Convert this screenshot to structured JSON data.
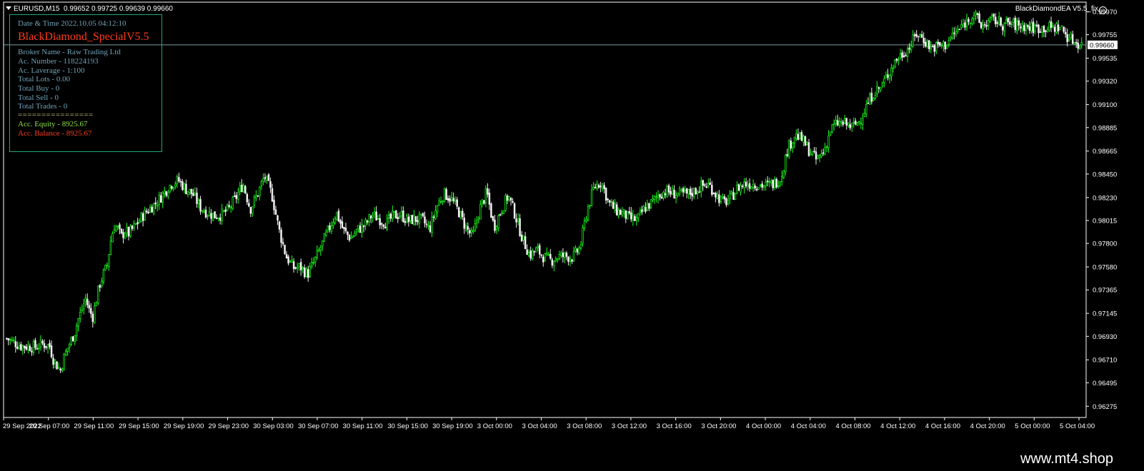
{
  "header": {
    "symbol": "EURUSD,M15",
    "ohlc": "0.99652 0.99725 0.99639 0.99660",
    "ea_name": "BlackDiamondEA V5.5_fix"
  },
  "info_panel": {
    "datetime": "Date & Time 2022.10.05 04:12:10",
    "title": "BlackDiamond_SpecialV5.5",
    "broker": "Broker Name - Raw Trading Ltd",
    "ac_number": "Ac. Number - 118224193",
    "leverage": "Ac. Laverage - 1:100",
    "total_lots": "Total Lots - 0.00",
    "total_buy": "Total Buy - 0",
    "total_sell": "Total Sell - 0",
    "total_trades": "Total Trades - 0",
    "separator": "================",
    "equity": "Acc. Equity - 8925.67",
    "balance": "Acc. Balance - 8925.67"
  },
  "chart_data": {
    "type": "candlestick",
    "symbol": "EURUSD",
    "timeframe": "M15",
    "current_price": 0.9966,
    "price_labels": [
      "0.99970",
      "0.99755",
      "0.99535",
      "0.99320",
      "0.99100",
      "0.98885",
      "0.98665",
      "0.98450",
      "0.98230",
      "0.98015",
      "0.97800",
      "0.97580",
      "0.97365",
      "0.97145",
      "0.96930",
      "0.96710",
      "0.96495",
      "0.96275"
    ],
    "price_values": [
      0.9997,
      0.99755,
      0.99535,
      0.9932,
      0.991,
      0.98885,
      0.98665,
      0.9845,
      0.9823,
      0.98015,
      0.978,
      0.9758,
      0.97365,
      0.97145,
      0.9693,
      0.9671,
      0.96495,
      0.96275
    ],
    "time_labels": [
      "29 Sep 2022",
      "29 Sep 07:00",
      "29 Sep 11:00",
      "29 Sep 15:00",
      "29 Sep 19:00",
      "29 Sep 23:00",
      "30 Sep 03:00",
      "30 Sep 07:00",
      "30 Sep 11:00",
      "30 Sep 15:00",
      "30 Sep 19:00",
      "3 Oct 00:00",
      "3 Oct 04:00",
      "3 Oct 08:00",
      "3 Oct 12:00",
      "3 Oct 16:00",
      "3 Oct 20:00",
      "4 Oct 00:00",
      "4 Oct 04:00",
      "4 Oct 08:00",
      "4 Oct 12:00",
      "4 Oct 16:00",
      "4 Oct 20:00",
      "5 Oct 00:00",
      "5 Oct 04:00"
    ],
    "y_range": [
      0.9617,
      1.0006
    ],
    "close_path": [
      [
        0,
        0.9691
      ],
      [
        2,
        0.9684
      ],
      [
        4,
        0.9683
      ],
      [
        5,
        0.9686
      ],
      [
        6,
        0.9684
      ],
      [
        6.5,
        0.9672
      ],
      [
        7,
        0.9666
      ],
      [
        7.5,
        0.9661
      ],
      [
        8,
        0.9673
      ],
      [
        8.5,
        0.9682
      ],
      [
        9,
        0.9689
      ],
      [
        9.5,
        0.9697
      ],
      [
        10,
        0.9709
      ],
      [
        10.5,
        0.9718
      ],
      [
        11,
        0.9729
      ],
      [
        11.5,
        0.9718
      ],
      [
        12,
        0.9711
      ],
      [
        12.5,
        0.9727
      ],
      [
        13,
        0.9742
      ],
      [
        13.5,
        0.9751
      ],
      [
        14,
        0.9759
      ],
      [
        14.5,
        0.9782
      ],
      [
        15,
        0.9797
      ],
      [
        15.5,
        0.9794
      ],
      [
        16,
        0.9786
      ],
      [
        16.5,
        0.9792
      ],
      [
        17,
        0.9789
      ],
      [
        18,
        0.9797
      ],
      [
        19,
        0.9806
      ],
      [
        20,
        0.9813
      ],
      [
        21,
        0.9819
      ],
      [
        22,
        0.9828
      ],
      [
        23,
        0.9836
      ],
      [
        24,
        0.9839
      ],
      [
        25,
        0.9831
      ],
      [
        26,
        0.9826
      ],
      [
        27,
        0.9814
      ],
      [
        28,
        0.9809
      ],
      [
        29,
        0.9806
      ],
      [
        30,
        0.9807
      ],
      [
        31,
        0.9812
      ],
      [
        32,
        0.9823
      ],
      [
        33,
        0.9836
      ],
      [
        34,
        0.9812
      ],
      [
        35,
        0.9826
      ],
      [
        36,
        0.9843
      ],
      [
        37,
        0.9826
      ],
      [
        38,
        0.9793
      ],
      [
        39,
        0.9768
      ],
      [
        40,
        0.9757
      ],
      [
        41,
        0.9758
      ],
      [
        42,
        0.9751
      ],
      [
        43,
        0.9764
      ],
      [
        44,
        0.9779
      ],
      [
        45,
        0.9794
      ],
      [
        46,
        0.9809
      ],
      [
        47,
        0.9792
      ],
      [
        48,
        0.9785
      ],
      [
        49,
        0.9793
      ],
      [
        50,
        0.9797
      ],
      [
        51,
        0.9807
      ],
      [
        52,
        0.9803
      ],
      [
        53,
        0.9799
      ],
      [
        54,
        0.9806
      ],
      [
        55,
        0.9807
      ],
      [
        56,
        0.9801
      ],
      [
        57,
        0.9803
      ],
      [
        58,
        0.9802
      ],
      [
        59,
        0.9793
      ],
      [
        60,
        0.9814
      ],
      [
        61,
        0.9827
      ],
      [
        62,
        0.9822
      ],
      [
        63,
        0.9811
      ],
      [
        64,
        0.9796
      ],
      [
        65,
        0.9786
      ],
      [
        66,
        0.9812
      ],
      [
        67,
        0.9828
      ],
      [
        68,
        0.9795
      ],
      [
        69,
        0.9811
      ],
      [
        70,
        0.9825
      ],
      [
        71,
        0.9806
      ],
      [
        72,
        0.9784
      ],
      [
        73,
        0.9769
      ],
      [
        74,
        0.9774
      ],
      [
        75,
        0.9767
      ],
      [
        76,
        0.9764
      ],
      [
        77,
        0.9768
      ],
      [
        78,
        0.9768
      ],
      [
        79,
        0.9767
      ],
      [
        80,
        0.9776
      ],
      [
        81,
        0.9811
      ],
      [
        82,
        0.9833
      ],
      [
        83,
        0.9838
      ],
      [
        84,
        0.9818
      ],
      [
        85,
        0.9811
      ],
      [
        86,
        0.9808
      ],
      [
        87,
        0.9803
      ],
      [
        88,
        0.9802
      ],
      [
        89,
        0.9813
      ],
      [
        90,
        0.9818
      ],
      [
        91,
        0.9826
      ],
      [
        92,
        0.9829
      ],
      [
        93,
        0.9827
      ],
      [
        94,
        0.9826
      ],
      [
        95,
        0.9826
      ],
      [
        96,
        0.9829
      ],
      [
        97,
        0.9834
      ],
      [
        98,
        0.9835
      ],
      [
        99,
        0.9826
      ],
      [
        100,
        0.9818
      ],
      [
        101,
        0.9822
      ],
      [
        102,
        0.9832
      ],
      [
        103,
        0.9836
      ],
      [
        104,
        0.9836
      ],
      [
        105,
        0.9835
      ],
      [
        106,
        0.9834
      ],
      [
        107,
        0.9836
      ],
      [
        108,
        0.9841
      ],
      [
        109,
        0.9869
      ],
      [
        110,
        0.9882
      ],
      [
        111,
        0.9877
      ],
      [
        112,
        0.9867
      ],
      [
        113,
        0.9858
      ],
      [
        114,
        0.9866
      ],
      [
        115,
        0.9887
      ],
      [
        116,
        0.9893
      ],
      [
        117,
        0.9892
      ],
      [
        118,
        0.9889
      ],
      [
        119,
        0.9895
      ],
      [
        120,
        0.9909
      ],
      [
        121,
        0.9922
      ],
      [
        122,
        0.9926
      ],
      [
        123,
        0.9939
      ],
      [
        124,
        0.9951
      ],
      [
        125,
        0.9958
      ],
      [
        126,
        0.9964
      ],
      [
        127,
        0.9977
      ],
      [
        128,
        0.9971
      ],
      [
        129,
        0.9963
      ],
      [
        130,
        0.9965
      ],
      [
        131,
        0.9966
      ],
      [
        132,
        0.9975
      ],
      [
        133,
        0.9981
      ],
      [
        134,
        0.9989
      ],
      [
        135,
        0.9995
      ],
      [
        136,
        0.9983
      ],
      [
        137,
        0.9988
      ],
      [
        138,
        0.9989
      ],
      [
        139,
        0.9985
      ],
      [
        140,
        0.9986
      ],
      [
        141,
        0.9984
      ],
      [
        142,
        0.9984
      ],
      [
        143,
        0.9982
      ],
      [
        144,
        0.9982
      ],
      [
        145,
        0.9982
      ],
      [
        146,
        0.9982
      ],
      [
        147,
        0.9983
      ],
      [
        148,
        0.9974
      ],
      [
        149,
        0.9969
      ],
      [
        150,
        0.9966
      ]
    ],
    "grid": false,
    "bull_color": "#18ff18",
    "bear_color": "#f0f0f0",
    "price_line_color": "#7b9e9e"
  },
  "footer": {
    "site": "www.mt4.shop"
  }
}
